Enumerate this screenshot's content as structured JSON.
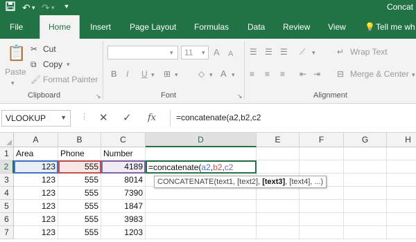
{
  "titlebar": {
    "title": "Concat",
    "save_icon": "save-icon",
    "undo_icon": "undo-icon",
    "redo_icon": "redo-icon",
    "customize_icon": "customize-qat-icon"
  },
  "tabs": [
    {
      "label": "File"
    },
    {
      "label": "Home"
    },
    {
      "label": "Insert"
    },
    {
      "label": "Page Layout"
    },
    {
      "label": "Formulas"
    },
    {
      "label": "Data"
    },
    {
      "label": "Review"
    },
    {
      "label": "View"
    },
    {
      "label": "Tell me wh"
    }
  ],
  "ribbon": {
    "clipboard": {
      "paste": "Paste",
      "cut": "Cut",
      "copy": "Copy",
      "format_painter": "Format Painter",
      "label": "Clipboard"
    },
    "font": {
      "font_size": "11",
      "bold": "B",
      "italic": "I",
      "underline": "U",
      "grow": "A",
      "shrink": "A",
      "label": "Font"
    },
    "alignment": {
      "wrap_text": "Wrap Text",
      "merge_center": "Merge & Center",
      "label": "Alignment"
    }
  },
  "formula_bar": {
    "name_box": "VLOOKUP",
    "cancel": "✕",
    "enter": "✓",
    "fx": "fx",
    "formula": "=concatenate(a2,b2,c2"
  },
  "grid": {
    "columns": [
      "A",
      "B",
      "C",
      "D",
      "E",
      "F",
      "G",
      "H"
    ],
    "rows": [
      "1",
      "2",
      "3",
      "4",
      "5",
      "6",
      "7"
    ],
    "header_row": {
      "a": "Area",
      "b": "Phone",
      "c": "Number"
    },
    "data_rows": [
      {
        "a": "123",
        "b": "555",
        "c": "4189"
      },
      {
        "a": "123",
        "b": "555",
        "c": "8014"
      },
      {
        "a": "123",
        "b": "555",
        "c": "7390"
      },
      {
        "a": "123",
        "b": "555",
        "c": "1847"
      },
      {
        "a": "123",
        "b": "555",
        "c": "3983"
      },
      {
        "a": "123",
        "b": "555",
        "c": "1203"
      }
    ],
    "editing_cell": {
      "prefix": "=concatenate(",
      "ref1": "a2",
      "comma1": ",",
      "ref2": "b2",
      "comma2": ",",
      "ref3": "c2"
    },
    "tooltip": {
      "before": "CONCATENATE(text1, [text2], ",
      "current": "[text3]",
      "after": ", [text4], ...)"
    }
  },
  "colors": {
    "accent": "#217346",
    "ref1": "#4472c4",
    "ref2": "#c0504d",
    "ref3": "#8064a2"
  }
}
